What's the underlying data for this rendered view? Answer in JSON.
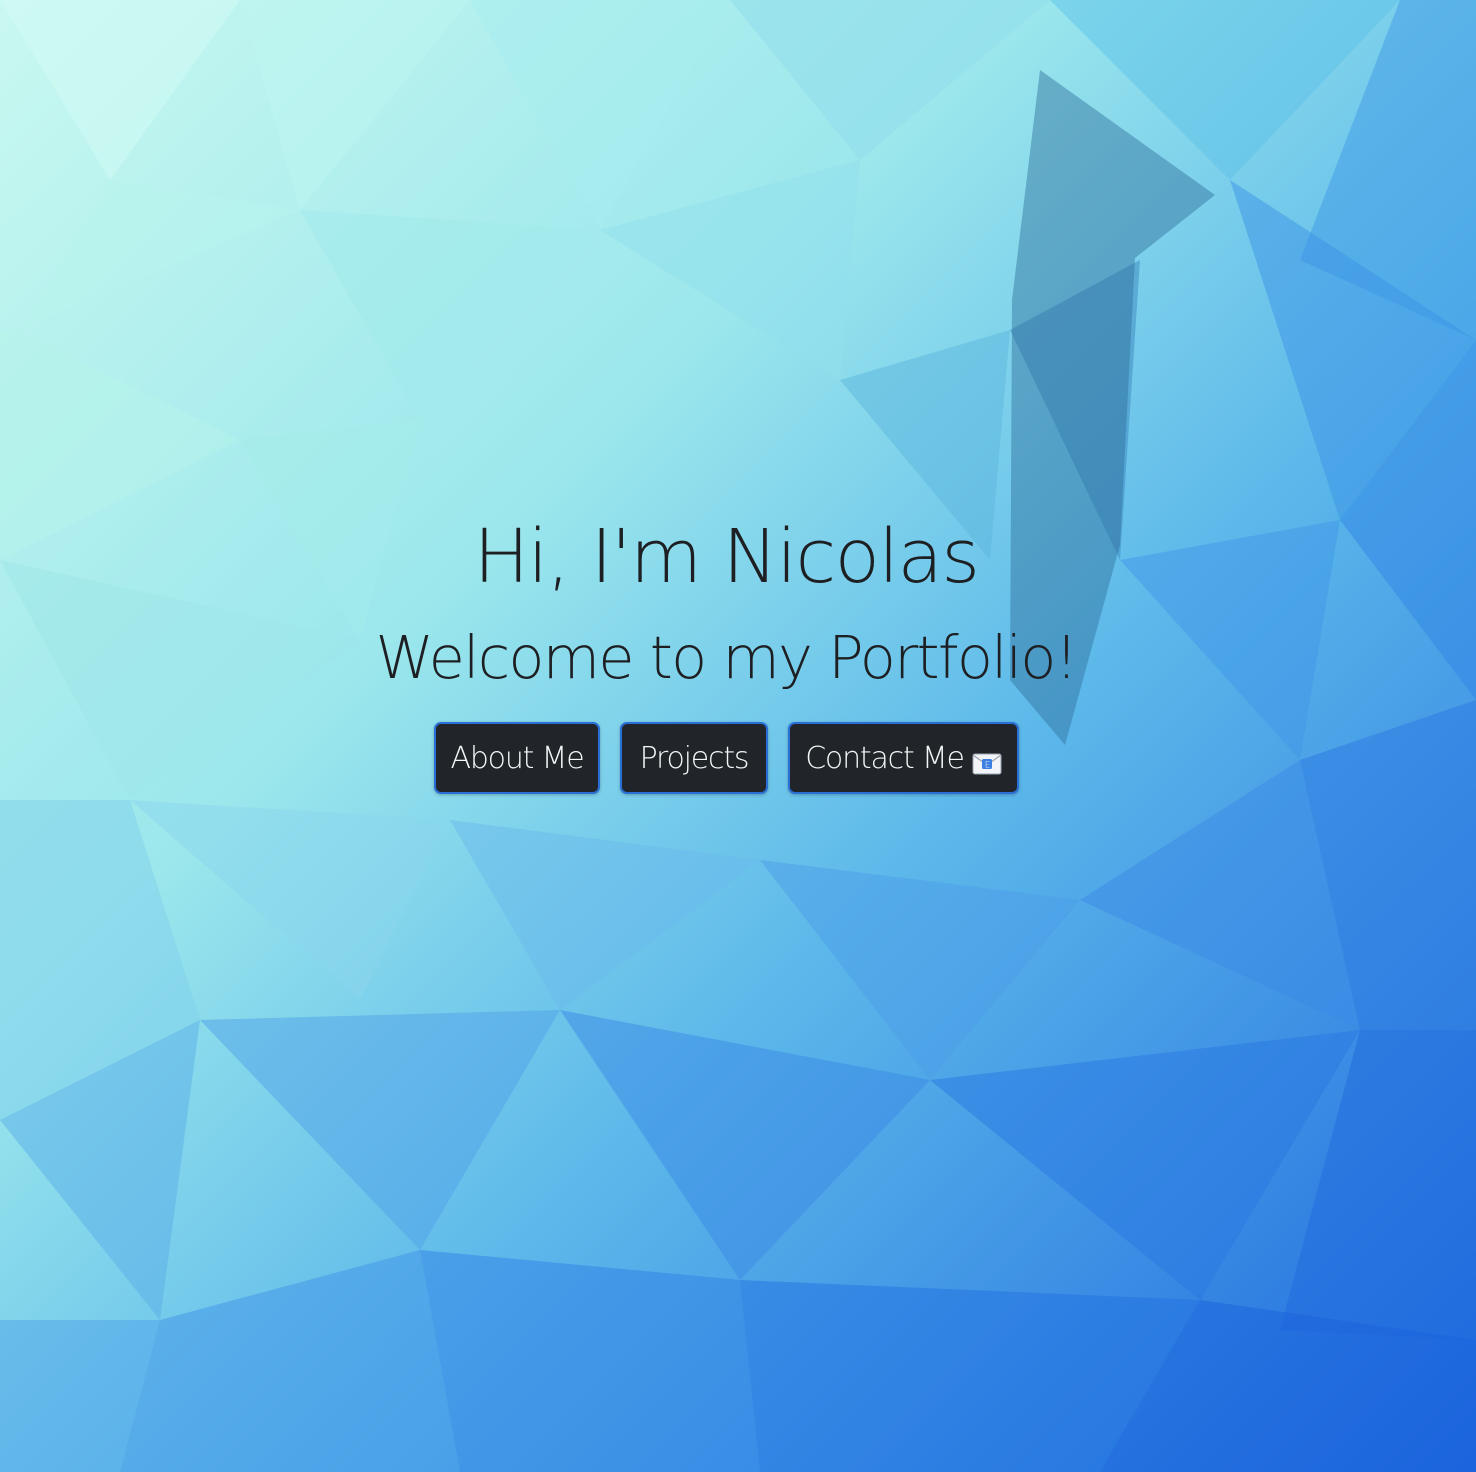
{
  "hero": {
    "greeting": "Hi, I'm Nicolas",
    "subtitle": "Welcome to my Portfolio!"
  },
  "nav": {
    "about_label": "About Me",
    "projects_label": "Projects",
    "contact_label": "Contact Me",
    "contact_icon": "email-icon"
  },
  "colors": {
    "button_bg": "#212529",
    "button_border": "#2a6fd6",
    "button_text": "#f4f6f8",
    "heading_text": "#1d1f22",
    "background_top_left": "#c8f7f0",
    "background_bottom_right": "#1e6ee0"
  }
}
